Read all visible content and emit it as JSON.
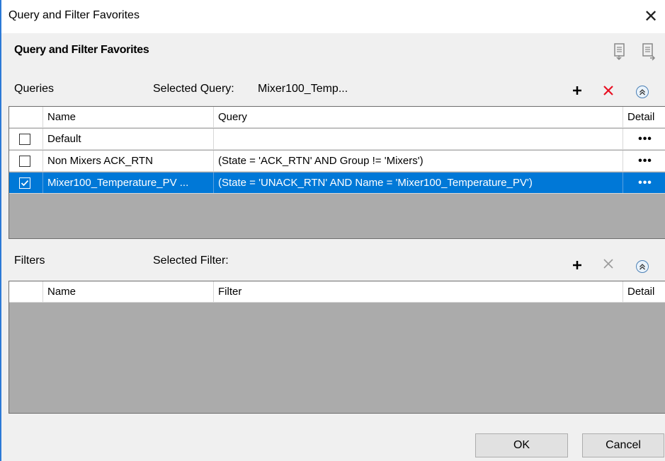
{
  "window": {
    "title": "Query and Filter Favorites"
  },
  "header": {
    "title": "Query and Filter Favorites"
  },
  "queries": {
    "label": "Queries",
    "selected_label": "Selected Query:",
    "selected_value": "Mixer100_Temp...",
    "columns": {
      "name": "Name",
      "query": "Query",
      "detail": "Detail"
    },
    "rows": [
      {
        "checked": false,
        "name": "Default",
        "query": "",
        "detail": "•••"
      },
      {
        "checked": false,
        "name": "Non Mixers ACK_RTN",
        "query": "(State = 'ACK_RTN' AND Group != 'Mixers')",
        "detail": "•••"
      },
      {
        "checked": true,
        "name": "Mixer100_Temperature_PV ...",
        "query": "(State = 'UNACK_RTN' AND Name = 'Mixer100_Temperature_PV')",
        "detail": "•••"
      }
    ]
  },
  "filters": {
    "label": "Filters",
    "selected_label": "Selected Filter:",
    "selected_value": "",
    "columns": {
      "name": "Name",
      "filter": "Filter",
      "detail": "Detail"
    }
  },
  "buttons": {
    "ok": "OK",
    "cancel": "Cancel"
  },
  "colors": {
    "selection": "#0078d7",
    "delete_active": "#e81123",
    "delete_disabled": "#9a9a9a",
    "grid_background": "#ababab"
  }
}
